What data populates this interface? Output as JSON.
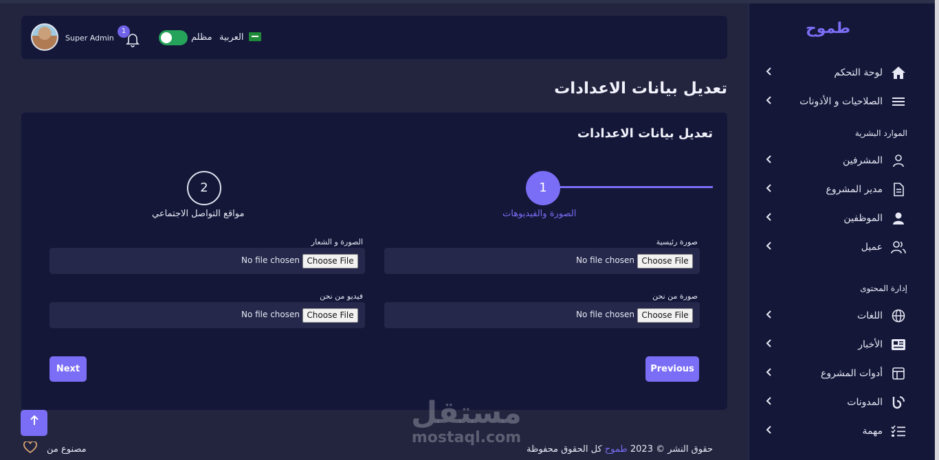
{
  "sidebar": {
    "brand": "طموح",
    "items_top": [
      {
        "label": "لوحة التحكم",
        "icon": "home-icon"
      },
      {
        "label": "الصلاحيات و الأذونات",
        "icon": "menu-icon"
      }
    ],
    "section_hr": "الموارد البشرية",
    "items_hr": [
      {
        "label": "المشرفين",
        "icon": "user-icon"
      },
      {
        "label": "مدير المشروع",
        "icon": "document-icon"
      },
      {
        "label": "الموظفين",
        "icon": "person-icon"
      },
      {
        "label": "عميل",
        "icon": "users-icon"
      }
    ],
    "section_content": "إدارة المحتوى",
    "items_content": [
      {
        "label": "اللغات",
        "icon": "globe-icon"
      },
      {
        "label": "الأخبار",
        "icon": "newspaper-icon"
      },
      {
        "label": "أدوات المشروع",
        "icon": "layout-icon"
      },
      {
        "label": "المدونات",
        "icon": "blog-icon"
      },
      {
        "label": "مهمة",
        "icon": "tasks-icon"
      }
    ]
  },
  "navbar": {
    "admin_name": "Super Admin",
    "notification_count": "1",
    "mode_label": "مظلم",
    "language_label": "العربية"
  },
  "page": {
    "title": "تعديل بيانات الاعدادات"
  },
  "card": {
    "title": "تعديل بيانات الاعدادات",
    "steps": [
      {
        "number": "1",
        "label": "الصورة والفيديوهات"
      },
      {
        "number": "2",
        "label": "مواقع التواصل الاجتماعي"
      }
    ],
    "fields": [
      {
        "label": "صورة رئيسية",
        "status": "No file chosen",
        "button": "Choose File"
      },
      {
        "label": "الصورة و الشعار",
        "status": "No file chosen",
        "button": "Choose File"
      },
      {
        "label": "صورة من نحن",
        "status": "No file chosen",
        "button": "Choose File"
      },
      {
        "label": "فيديو من نحن",
        "status": "No file chosen",
        "button": "Choose File"
      }
    ],
    "next_label": "Next",
    "previous_label": "Previous"
  },
  "footer": {
    "made_by": "مصنوع من",
    "copyright_prefix": "حقوق النشر © 2023",
    "brand": "طموح",
    "rights": "كل الحقوق محفوظة"
  },
  "watermark": {
    "arabic": "مستقل",
    "latin": "mostaql.com"
  },
  "colors": {
    "accent": "#7b6ef6",
    "sidebar_bg": "#141738",
    "page_bg": "#23253f",
    "toggle_on": "#25a35a"
  }
}
